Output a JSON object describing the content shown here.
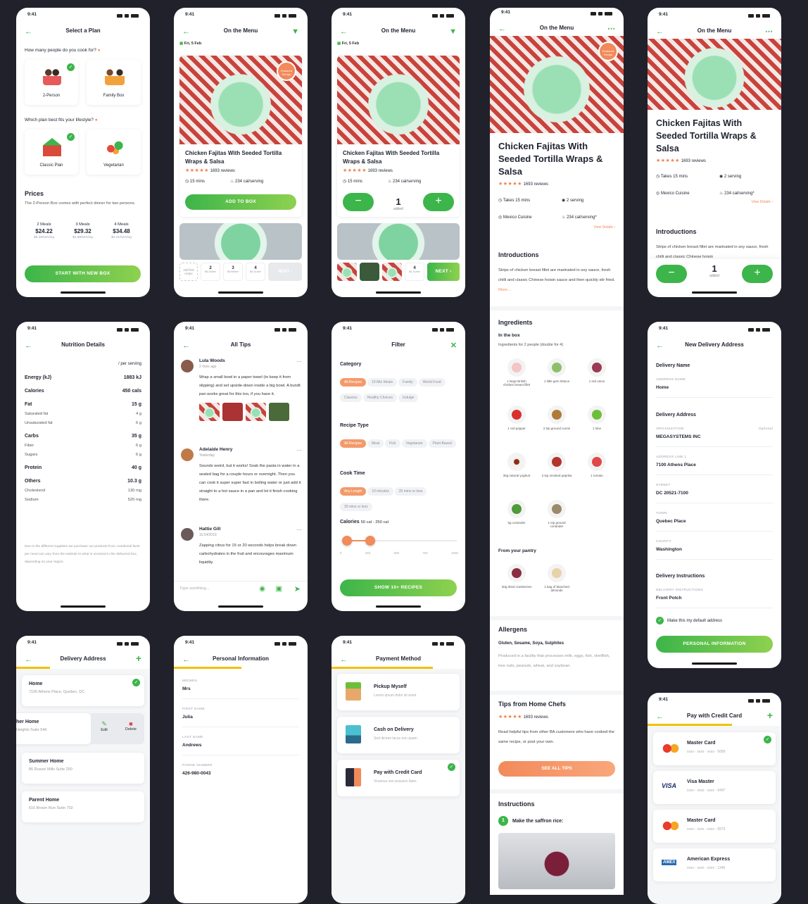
{
  "status_time": "9:41",
  "plan": {
    "title": "Select a Plan",
    "q1": "How many people do you cook for?",
    "o1": "2-Person",
    "o2": "Family Box",
    "q2": "Which plan best fits your lifestyle?",
    "o3": "Classic Plan",
    "o4": "Vegetarian",
    "prices_title": "Prices",
    "prices_desc": "The 2-Person Box comes with perfect dinner for two persons.",
    "p": [
      {
        "m": "2 Meals",
        "v": "$24.22",
        "s": "$6.25/serving"
      },
      {
        "m": "3 Meals",
        "v": "$29.32",
        "s": "$4.88/serving"
      },
      {
        "m": "4 Meals",
        "v": "$34.48",
        "s": "$4.31/serving"
      }
    ],
    "btn": "START WITH NEW BOX"
  },
  "menu": {
    "title": "On the Menu",
    "date": "Fri, 5 Feb",
    "badge": "Featured Recipe",
    "dish": "Chicken Fajitas With Seeded Tortilla Wraps & Salsa",
    "reviews": "1693 reviews",
    "time": "15 mins",
    "cal": "234 cal/serving",
    "add": "ADD TO BOX",
    "added": "added",
    "qty": "1",
    "addfirst": "Add first recipe",
    "slots": [
      {
        "n": "2",
        "p": "$6.25/ser"
      },
      {
        "n": "3",
        "p": "$4.88/ser"
      },
      {
        "n": "4",
        "p": "$4.31/ser"
      }
    ],
    "next": "NEXT"
  },
  "detail": {
    "title": "On the Menu",
    "dish": "Chicken Fajitas With Seeded Tortilla Wraps & Salsa",
    "reviews": "1693 reviews",
    "takes": "Takes 15 mins",
    "serving": "2 serving",
    "cuisine": "Mexico Cuisine",
    "cal": "234 cal/serving*",
    "view": "View Details",
    "intro_h": "Introductions",
    "intro": "Strips of chicken breast fillet are marinated in soy sauce, fresh chilli and classic Chinese hoisin sauce and then quickly stir fried.",
    "more": "More...",
    "ing_h": "Ingredients",
    "inbox": "In the box",
    "inbox_sub": "Ingredients for 2 people (double for 4)",
    "ings": [
      "1 large British chicken breast fillet",
      "1 little gem lettuce",
      "1 red onion",
      "1 red pepper",
      "2 tsp ground cumin",
      "1 lime",
      "30g natural yoghurt",
      "2 tsp smoked paprika",
      "1 tomato",
      "5g coriander",
      "1 tsp ground coriander"
    ],
    "pantry_h": "From your pantry",
    "pantry": [
      "30g dried cranberries",
      "1 bag of blanched almonds"
    ],
    "allergens_h": "Allergens",
    "allergens": "Gluten, Sesame, Soya, Sulphites",
    "allergens_note": "Produced in a facility that processes milk, eggs, fish, shellfish, tree nuts, peanuts, wheat, and soybean.",
    "tips_h": "Tips from Home Chefs",
    "tips_rev": "1693 reviews",
    "tips_text": "Read helpful tips from other BA customers who have cooked the same recipe, or post your own.",
    "tips_btn": "SEE ALL TIPS",
    "instr_h": "Instructions",
    "step_n": "1",
    "step": "Make the saffron rice:"
  },
  "detail2": {
    "intro_cut": "Strips of chicken breast fillet are marinated in soy sauce, fresh chilli and classic Chinese hoisin"
  },
  "nutri": {
    "title": "Nutrition Details",
    "per": "/ per serving",
    "rows": [
      {
        "k": "Energy (kJ)",
        "v": "1883 kJ",
        "b": true
      },
      {
        "k": "Calories",
        "v": "450 cals",
        "b": true
      },
      {
        "k": "Fat",
        "v": "15 g",
        "b": true
      },
      {
        "k": "Saturated fat",
        "v": "4 g"
      },
      {
        "k": "Unsaturated fat",
        "v": "6 g"
      },
      {
        "k": "Carbs",
        "v": "35 g",
        "b": true
      },
      {
        "k": "Fiber",
        "v": "6 g"
      },
      {
        "k": "Sugars",
        "v": "6 g"
      },
      {
        "k": "Protein",
        "v": "40 g",
        "b": true
      },
      {
        "k": "Others",
        "v": "10.3 g",
        "b": true
      },
      {
        "k": "Cholesterol",
        "v": "130 mg"
      },
      {
        "k": "Sodium",
        "v": "520 mg"
      }
    ],
    "note": "Due to the different suppliers we purchase our products from, nutritional facts per meal can vary from the website to what is received in the delivered box, depending on your region."
  },
  "tips": {
    "title": "All Tips",
    "t": [
      {
        "n": "Lula Woods",
        "d": "2 mins ago",
        "x": "Wrap a small bowl in a paper towel (to keep it from slipping) and set upside-down inside a big bowl. A bundt pan works great for this too, if you have it."
      },
      {
        "n": "Adelaide Henry",
        "d": "Yesterday",
        "x": "Sounds weird, but it works! Soak the pasta in water in a sealed bag for a couple hours or overnight. Then you can cook it super super fast in boiling water or just add it straight to a hot sauce in a pan and let it finish cooking there."
      },
      {
        "n": "Hattie Gill",
        "d": "11/14/2019",
        "x": "Zapping citrus for 15 or 20 seconds helps break down carbohydrates in the fruit and encourages maximum liquidity."
      }
    ],
    "ph": "Type somthing..."
  },
  "filter": {
    "title": "Filter",
    "cat_h": "Category",
    "cat": [
      "All Recipes",
      "10-Min Meals",
      "Family",
      "World Food",
      "Classics",
      "Healthy Choices",
      "Indulge"
    ],
    "type_h": "Recipe Type",
    "type": [
      "All Recipes",
      "Meat",
      "Fish",
      "Vegetarian",
      "Plant-Based"
    ],
    "cook_h": "Cook Time",
    "cook": [
      "Any Length",
      "10 minutes",
      "20 mins or less",
      "30 mins or less"
    ],
    "cal_h": "Calories",
    "cal_range": "50 cal - 250 cal",
    "ticks": [
      "0",
      "250",
      "500",
      "750",
      "1000"
    ],
    "slider": {
      "min": 50,
      "max": 250,
      "scale_max": 1000
    },
    "btn": "SHOW 10+ RECIPES"
  },
  "addr": {
    "title": "New Delivery Address",
    "s1": "Delivery Name",
    "l1": "ADDRESS NAME",
    "v1": "Home",
    "s2": "Delivery Address",
    "l2": "ORGANIZATION",
    "opt": "Optional",
    "v2": "MEGASYSTEMS INC",
    "l3": "ADDRESS LINE 1",
    "v3": "7100 Athens Place",
    "l4": "STREET",
    "v4": "DC 20521-7100",
    "l5": "TOWN",
    "v5": "Quebec Place",
    "l6": "COUNTY",
    "v6": "Washington",
    "s3": "Delivery Instructions",
    "l7": "DELIVERY INSTRUCTIONS",
    "v7": "Front Potch",
    "default": "Make this my default address",
    "btn": "PERSONAL INFORMATION"
  },
  "dlist": {
    "title": "Delivery Address",
    "items": [
      {
        "n": "Home",
        "a": "7100 Athens Place, Quebec, DC"
      },
      {
        "n": "her Home",
        "a": "Heights Suite 546"
      },
      {
        "n": "Summer Home",
        "a": "86 Russel Mills Suite 250"
      },
      {
        "n": "Parent Home",
        "a": "616 Brown Run Suite 702"
      }
    ],
    "edit": "Edit",
    "delete": "Delete"
  },
  "personal": {
    "title": "Personal Information",
    "f": [
      {
        "l": "MR/MRS",
        "v": "Mrs"
      },
      {
        "l": "FIRST NAME",
        "v": "Julia"
      },
      {
        "l": "LAST NAME",
        "v": "Andrews"
      },
      {
        "l": "PHONE NUMBER",
        "v": "426-980-0043"
      }
    ]
  },
  "payment": {
    "title": "Payment Method",
    "m": [
      {
        "n": "Pickup Myself",
        "d": "Lorem ipsum dolor sit amet"
      },
      {
        "n": "Cash on Delivery",
        "d": "Sed dictum lacus non quam"
      },
      {
        "n": "Pay with Credit Card",
        "d": "Vivamus non posuere diam"
      }
    ]
  },
  "cards": {
    "title": "Pay with Credit Card",
    "c": [
      {
        "n": "Master Card",
        "num": "xxxx - xxxx - xxxx - 5689",
        "b": "mc"
      },
      {
        "n": "Visa Master",
        "num": "xxxx - xxxx - xxxx - 6497",
        "b": "VISA"
      },
      {
        "n": "Master Card",
        "num": "xxxx - xxxx - xxxx - 8973",
        "b": "mc"
      },
      {
        "n": "American Express",
        "num": "xxxx - xxxx - xxxx - 1346",
        "b": "AMEX"
      }
    ]
  },
  "colors": {
    "green": "#3cb54a",
    "orange": "#f28a5a",
    "bg": "#20212b"
  }
}
